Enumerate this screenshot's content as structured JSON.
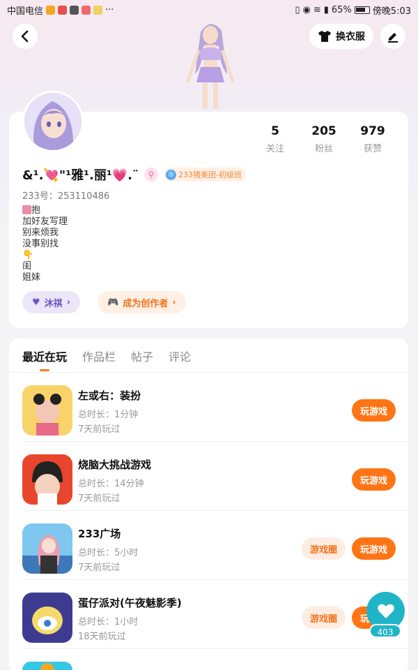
{
  "status_bar": {
    "carrier": "中国电信",
    "battery": "65%",
    "time": "傍晚5:03",
    "more": "···"
  },
  "header": {
    "outfit_label": "换衣服"
  },
  "profile": {
    "nickname": "&¹.💘\"¹雅¹.丽¹💗.¨",
    "gender_icon": "⚲",
    "group_badge": "233猪美团-初级班",
    "uid": "233号：253110486",
    "bio_lines": [
      "抱",
      "加好友写理",
      "别来烦我",
      "没事别找",
      "👇",
      "闺",
      "姐妹"
    ],
    "stats": [
      {
        "num": "5",
        "label": "关注"
      },
      {
        "num": "205",
        "label": "粉丝"
      },
      {
        "num": "979",
        "label": "获赞"
      }
    ],
    "family_label": "沐祺",
    "creator_label": "成为创作者"
  },
  "tabs": [
    "最近在玩",
    "作品栏",
    "帖子",
    "评论"
  ],
  "games": [
    {
      "name": "左或右：装扮",
      "duration": "总时长：1分钟",
      "last": "7天前玩过",
      "play": "玩游戏"
    },
    {
      "name": "烧脑大挑战游戏",
      "duration": "总时长：14分钟",
      "last": "7天前玩过",
      "play": "玩游戏"
    },
    {
      "name": "233广场",
      "duration": "总时长：5小时",
      "last": "7天前玩过",
      "play": "玩游戏",
      "circle": "游戏圈"
    },
    {
      "name": "蛋仔派对(午夜魅影季)",
      "duration": "总时长：1小时",
      "last": "18天前玩过",
      "play": "玩游戏",
      "circle": "游戏圈"
    }
  ],
  "like": {
    "count": "403"
  }
}
